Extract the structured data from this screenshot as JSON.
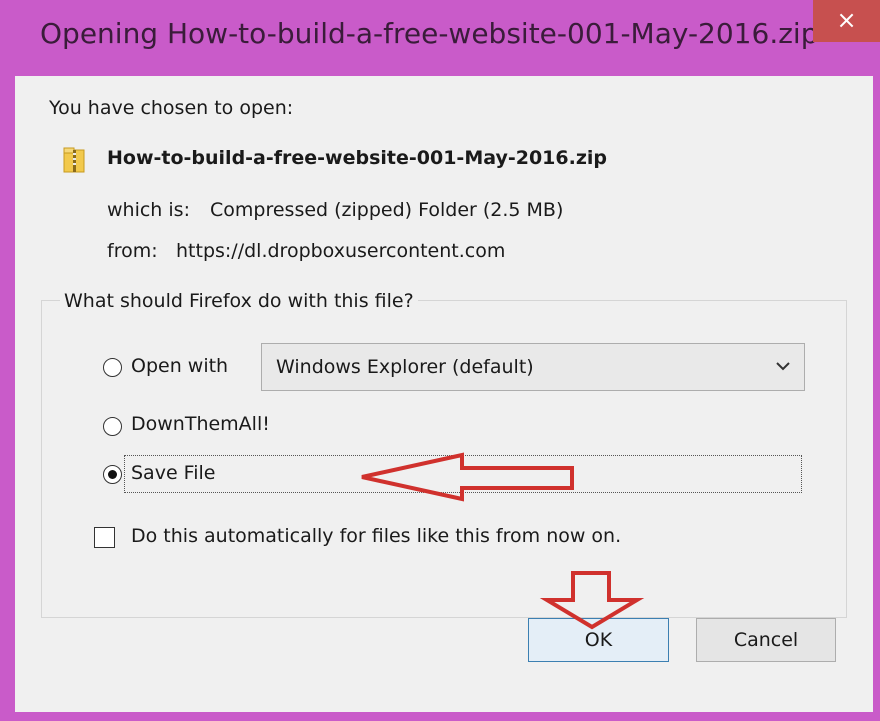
{
  "window": {
    "title": "Opening How-to-build-a-free-website-001-May-2016.zip",
    "close_label": "×"
  },
  "intro": "You have chosen to open:",
  "file": {
    "name": "How-to-build-a-free-website-001-May-2016.zip",
    "icon": "zip-folder-icon",
    "type_label": "which is:",
    "type_value": "Compressed (zipped) Folder (2.5 MB)",
    "from_label": "from:",
    "from_value": "https://dl.dropboxusercontent.com"
  },
  "group": {
    "title": "What should Firefox do with this file?",
    "options": [
      {
        "label": "Open with",
        "selected": false
      },
      {
        "label": "DownThemAll!",
        "selected": false
      },
      {
        "label": "Save File",
        "selected": true
      }
    ],
    "open_with_value": "Windows Explorer (default)",
    "auto_label": "Do this automatically for files like this from now on.",
    "auto_checked": false
  },
  "buttons": {
    "ok": "OK",
    "cancel": "Cancel"
  },
  "colors": {
    "titlebar": "#c95bc9",
    "close": "#c7504f",
    "annotation": "#d0312d",
    "client": "#f0f0f0"
  }
}
